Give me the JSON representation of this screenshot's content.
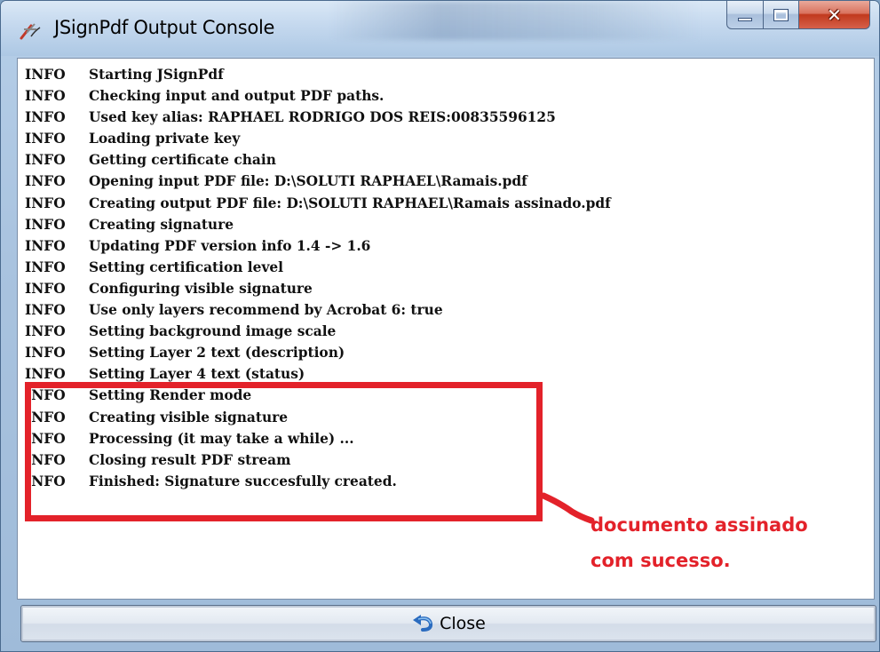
{
  "window": {
    "title": "JSignPdf Output Console"
  },
  "caption_buttons": {
    "minimize": "minimize",
    "maximize": "maximize",
    "close": "close"
  },
  "log": [
    {
      "level": "INFO",
      "message": "Starting JSignPdf"
    },
    {
      "level": "INFO",
      "message": "Checking input and output PDF paths."
    },
    {
      "level": "INFO",
      "message": "Used key alias: RAPHAEL RODRIGO DOS REIS:00835596125"
    },
    {
      "level": "INFO",
      "message": "Loading private key"
    },
    {
      "level": "INFO",
      "message": "Getting certificate chain"
    },
    {
      "level": "INFO",
      "message": "Opening input PDF file: D:\\SOLUTI RAPHAEL\\Ramais.pdf"
    },
    {
      "level": "INFO",
      "message": "Creating output PDF file: D:\\SOLUTI RAPHAEL\\Ramais assinado.pdf"
    },
    {
      "level": "INFO",
      "message": "Creating signature"
    },
    {
      "level": "INFO",
      "message": "Updating PDF version info 1.4 -> 1.6"
    },
    {
      "level": "INFO",
      "message": "Setting certification level"
    },
    {
      "level": "INFO",
      "message": "Configuring visible signature"
    },
    {
      "level": "INFO",
      "message": "Use only layers recommend by Acrobat 6: true"
    },
    {
      "level": "INFO",
      "message": "Setting background image scale"
    },
    {
      "level": "INFO",
      "message": "Setting Layer 2 text (description)"
    },
    {
      "level": "INFO",
      "message": "Setting Layer 4 text (status)"
    },
    {
      "level": "INFO",
      "message": "Setting Render mode"
    },
    {
      "level": "INFO",
      "message": "Creating visible signature"
    },
    {
      "level": "INFO",
      "message": "Processing (it may take a while) ..."
    },
    {
      "level": "INFO",
      "message": "Closing result PDF stream"
    },
    {
      "level": "INFO",
      "message": "Finished: Signature succesfully created."
    }
  ],
  "annotation": {
    "line1": "documento assinado",
    "line2": "com sucesso.",
    "color": "#e3222a"
  },
  "close_button": {
    "label": "Close",
    "icon": "undo-arrow-icon"
  }
}
